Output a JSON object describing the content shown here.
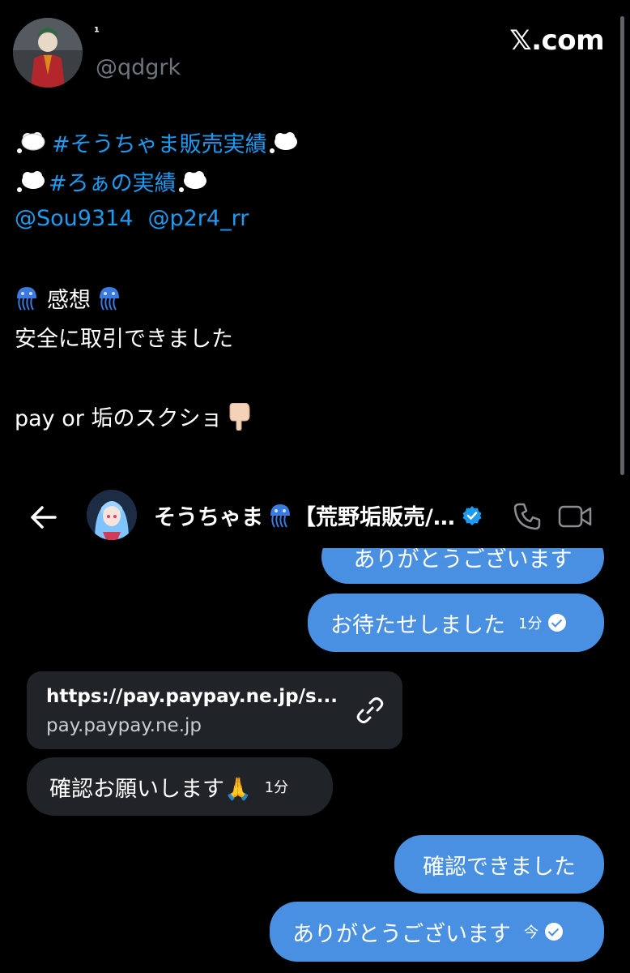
{
  "tweet": {
    "display_name": "¹",
    "handle": "@qdgrk",
    "site_label": "𝕏.com",
    "lines": {
      "hashtag1": "#そうちゃま販売実績",
      "hashtag2": "#ろぁの実績",
      "mention1": "@Sou9314",
      "mention2": "@p2r4_rr",
      "impression_heading": "感想",
      "impression_text": "安全に取引できました",
      "screenshot_note": "pay or 垢のスクショ"
    },
    "icons": {
      "cloud": "thought-balloon-icon",
      "jellyfish": "jellyfish-icon",
      "pointing": "backhand-pointing-down-icon"
    }
  },
  "dm": {
    "contact_name": "そうちゃま",
    "contact_name_suffix": "【荒野垢販売/…",
    "messages": [
      {
        "direction": "out",
        "text": "ありがとうございます",
        "time": ""
      },
      {
        "direction": "out",
        "text": "お待たせしました",
        "time": "1分"
      },
      {
        "direction": "in",
        "type": "link",
        "url": "https://pay.paypay.ne.jp/s...",
        "domain": "pay.paypay.ne.jp"
      },
      {
        "direction": "in",
        "text": "確認お願いします🙏",
        "time": "1分"
      },
      {
        "direction": "out",
        "text": "確認できました",
        "time": ""
      },
      {
        "direction": "out",
        "text": "ありがとうございます",
        "time": "今"
      }
    ]
  },
  "colors": {
    "background": "#000000",
    "link": "#1d9bf0",
    "outgoing_bubble": "#4a90e2",
    "incoming_bubble": "#202327",
    "handle_gray": "#6e767d"
  }
}
